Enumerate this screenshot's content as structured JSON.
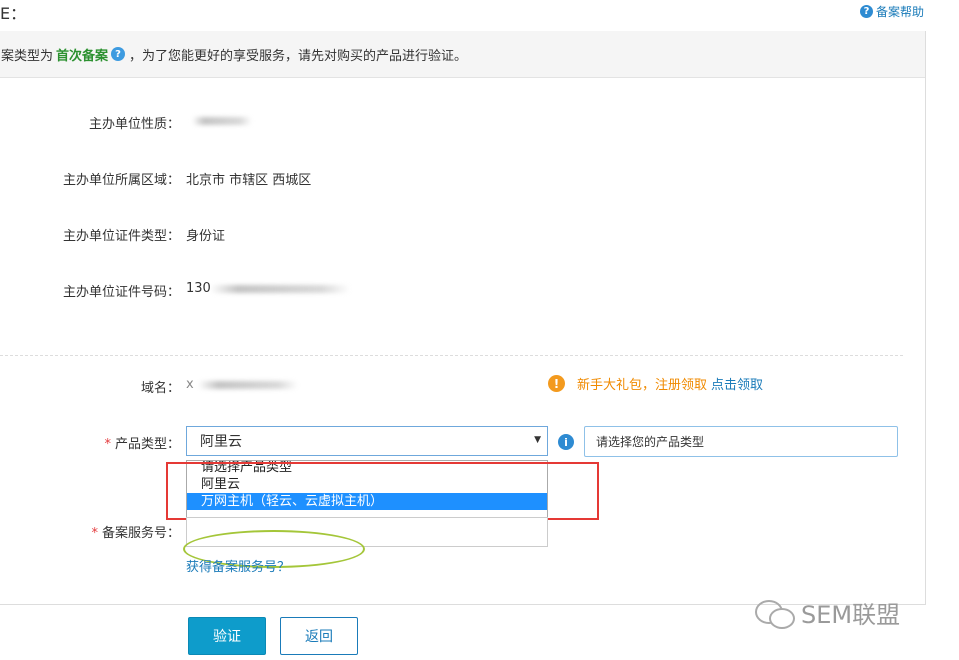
{
  "header": {
    "title": "E：",
    "help_label": "备案帮助",
    "help_icon": "question-circle-icon"
  },
  "notice": {
    "prefix": "案类型为",
    "highlight": "首次备案",
    "suffix": "，为了您能更好的享受服务，请先对购买的产品进行验证。"
  },
  "fields": {
    "org_nature_label": "主办单位性质：",
    "org_region_label": "主办单位所属区域：",
    "org_region_value": "北京市 市辖区 西城区",
    "cert_type_label": "主办单位证件类型：",
    "cert_type_value": "身份证",
    "cert_no_label": "主办单位证件号码：",
    "cert_no_value": "130",
    "domain_label": "域名：",
    "domain_value": "x",
    "product_type_label": "产品类型：",
    "service_no_label": "备案服务号："
  },
  "required_mark": "*",
  "gift": {
    "icon_text": "!",
    "text": "新手大礼包，注册领取",
    "link": "点击领取"
  },
  "product_select": {
    "selected": "阿里云",
    "arrow": "▼",
    "tip": "请选择您的产品类型",
    "options": [
      "请选择产品类型",
      "阿里云",
      "万网主机（轻云、云虚拟主机）"
    ],
    "highlighted_index": 2
  },
  "service_help_link": "获得备案服务号？",
  "buttons": {
    "verify": "验证",
    "back": "返回"
  },
  "watermark": "SEM联盟",
  "colors": {
    "accent": "#1a7bb9",
    "primary_button": "#0e9ccb",
    "highlight_green": "#2c9130",
    "gift_orange": "#f08a00",
    "annotation_red": "#e53935",
    "annotation_green": "#a4c639"
  }
}
